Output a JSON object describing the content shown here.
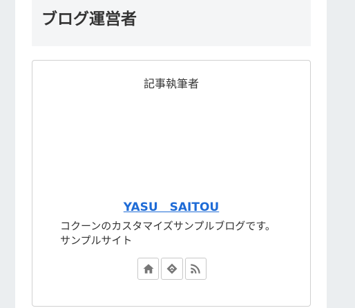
{
  "widget": {
    "title": "ブログ運営者"
  },
  "author_box": {
    "heading": "記事執筆者",
    "name": "YASU　SAITOU",
    "description": [
      "コクーンのカスタマイズサンプルブログです。",
      "サンプルサイト"
    ],
    "follow_buttons": [
      {
        "icon": "home-icon",
        "label": "home"
      },
      {
        "icon": "feedly-icon",
        "label": "feedly"
      },
      {
        "icon": "rss-icon",
        "label": "rss"
      }
    ]
  },
  "colors": {
    "link": "#1e6bd6",
    "title_bg": "#f4f5f6",
    "page_bg": "#ebeef0",
    "icon_gray": "#777777"
  }
}
